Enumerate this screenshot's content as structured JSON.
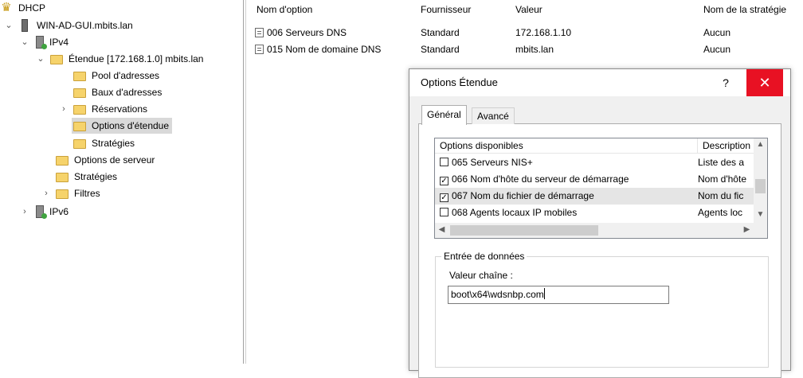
{
  "tree": {
    "dhcp": "DHCP",
    "server": "WIN-AD-GUI.mbits.lan",
    "ipv4": "IPv4",
    "scope": "Étendue [172.168.1.0] mbits.lan",
    "pool": "Pool d'adresses",
    "leases": "Baux d'adresses",
    "reservations": "Réservations",
    "scope_options": "Options d'étendue",
    "scope_policies": "Stratégies",
    "server_options": "Options de serveur",
    "policies": "Stratégies",
    "filters": "Filtres",
    "ipv6": "IPv6"
  },
  "list": {
    "headers": [
      "Nom d'option",
      "Fournisseur",
      "Valeur",
      "Nom de la stratégie"
    ],
    "rows": [
      {
        "name": "006 Serveurs DNS",
        "vendor": "Standard",
        "value": "172.168.1.10",
        "policy": "Aucun"
      },
      {
        "name": "015 Nom de domaine DNS",
        "vendor": "Standard",
        "value": "mbits.lan",
        "policy": "Aucun"
      }
    ]
  },
  "dialog": {
    "title": "Options Étendue",
    "help": "?",
    "close": "✕",
    "tabs": [
      "Général",
      "Avancé"
    ],
    "list_headers": [
      "Options disponibles",
      "Description"
    ],
    "options": [
      {
        "label": "065 Serveurs NIS+",
        "desc": "Liste des a",
        "checked": false
      },
      {
        "label": "066 Nom d'hôte du serveur de démarrage",
        "desc": "Nom d'hôte",
        "checked": true
      },
      {
        "label": "067 Nom du fichier de démarrage",
        "desc": "Nom du fic",
        "checked": true
      },
      {
        "label": "068 Agents locaux IP mobiles",
        "desc": "Agents loc",
        "checked": false
      }
    ],
    "group_title": "Entrée de données",
    "value_label": "Valeur chaîne :",
    "value": "boot\\x64\\wdsnbp.com"
  },
  "colors": {
    "selection": "#d9d9d9",
    "close_button": "#e81123"
  }
}
